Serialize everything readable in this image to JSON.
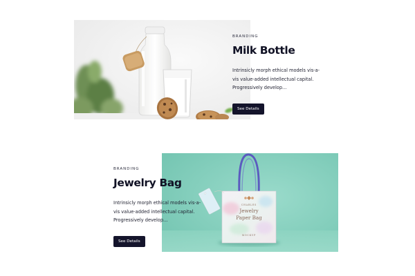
{
  "projects": [
    {
      "category": "BRANDING",
      "title": "Milk Bottle",
      "desc_lines": [
        "Intrinsicly morph ethical models vis-a-",
        "vis value-added intellectual capital.",
        "Progressively develop..."
      ],
      "button_label": "See Details"
    },
    {
      "category": "BRANDING",
      "title": "Jewelry Bag",
      "desc_lines": [
        "Intrinsicly morph ethical models vis-a-",
        "vis value-added intellectual capital.",
        "Progressively develop..."
      ],
      "button_label": "See Details"
    }
  ],
  "bag_mockup": {
    "brand": "CHARLES",
    "line1": "Jewelry",
    "line2": "Paper Bag",
    "footer": "MOCKUP"
  },
  "colors": {
    "button_bg": "#14142b",
    "bag_photo_bg": "#7fcfbd",
    "milk_photo_bg": "#f3f3f3"
  }
}
